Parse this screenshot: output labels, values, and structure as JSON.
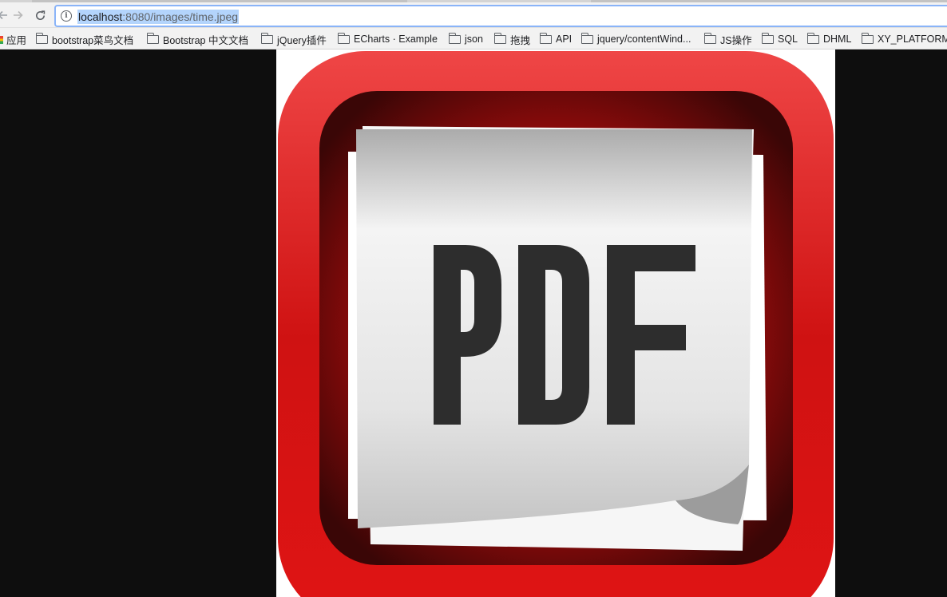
{
  "browser": {
    "address": {
      "host": "localhost",
      "path": ":8080/images/time.jpeg"
    },
    "bookmarks": [
      {
        "label": "应用",
        "type": "apps"
      },
      {
        "label": "bootstrap菜鸟文档",
        "type": "folder"
      },
      {
        "label": "Bootstrap 中文文档",
        "type": "folder"
      },
      {
        "label": "jQuery插件",
        "type": "folder"
      },
      {
        "label": "ECharts · Example",
        "type": "folder"
      },
      {
        "label": "json",
        "type": "folder"
      },
      {
        "label": "拖拽",
        "type": "folder"
      },
      {
        "label": "API",
        "type": "folder"
      },
      {
        "label": "jquery/contentWind...",
        "type": "folder"
      },
      {
        "label": "JS操作",
        "type": "folder"
      },
      {
        "label": "SQL",
        "type": "folder"
      },
      {
        "label": "DHML",
        "type": "folder"
      },
      {
        "label": "XY_PLATFORM",
        "type": "folder"
      }
    ]
  },
  "image": {
    "text": "PDF",
    "colors": {
      "frame_red": "#e31818",
      "frame_dark": "#5a0b0b",
      "paper": "#e6e6e6",
      "letters": "#2d2d2d",
      "page_background": "#0e0e0e"
    }
  }
}
